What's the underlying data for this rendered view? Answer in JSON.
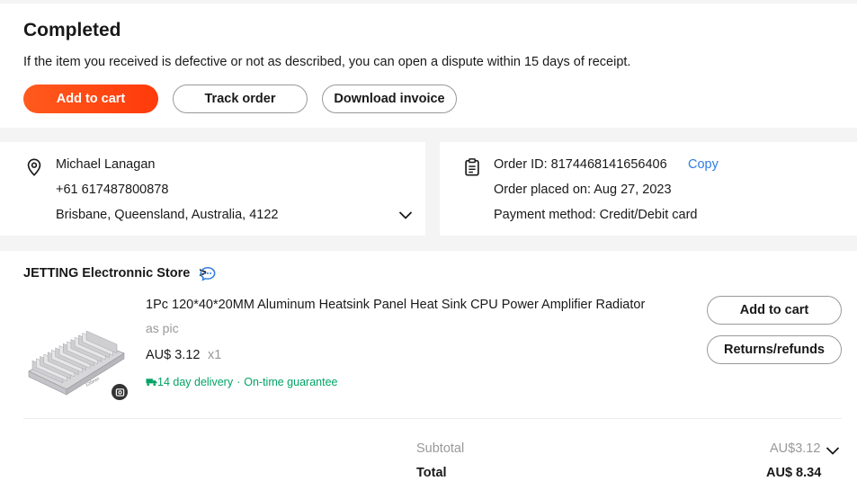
{
  "status": {
    "title": "Completed",
    "message": "If the item you received is defective or not as described, you can open a dispute within 15 days of receipt.",
    "buttons": {
      "add_to_cart": "Add to cart",
      "track_order": "Track order",
      "download_invoice": "Download invoice"
    }
  },
  "address": {
    "name": "Michael Lanagan",
    "phone": "+61 617487800878",
    "location": "Brisbane, Queensland, Australia, 4122"
  },
  "order": {
    "id_line": "Order ID: 8174468141656406",
    "copy_label": "Copy",
    "placed_line": "Order placed on: Aug 27, 2023",
    "payment_line": "Payment method: Credit/Debit card"
  },
  "store": {
    "name": "JETTING Electronnic Store",
    "chevron": ">"
  },
  "product": {
    "title": "1Pc 120*40*20MM Aluminum Heatsink Panel Heat Sink CPU Power Amplifier Radiator",
    "sku": "as pic",
    "price": "AU$ 3.12",
    "quantity": "x1",
    "delivery": "14 day delivery",
    "guarantee": "On-time guarantee",
    "separator": "·",
    "image_caption": "120mm",
    "actions": {
      "add_to_cart": "Add to cart",
      "returns": "Returns/refunds"
    }
  },
  "summary": {
    "subtotal_label": "Subtotal",
    "subtotal_value": "AU$3.12",
    "total_label": "Total",
    "total_value": "AU$ 8.34"
  },
  "colors": {
    "accent": "#ff4a14",
    "link": "#2e7de1",
    "success": "#00a366",
    "muted": "#999999"
  },
  "icons": {
    "address": "location-pin-icon",
    "order": "clipboard-icon",
    "store_chat": "chat-bubble-icon",
    "expand": "chevron-down-icon",
    "truck": "truck-icon",
    "camera": "camera-icon"
  }
}
